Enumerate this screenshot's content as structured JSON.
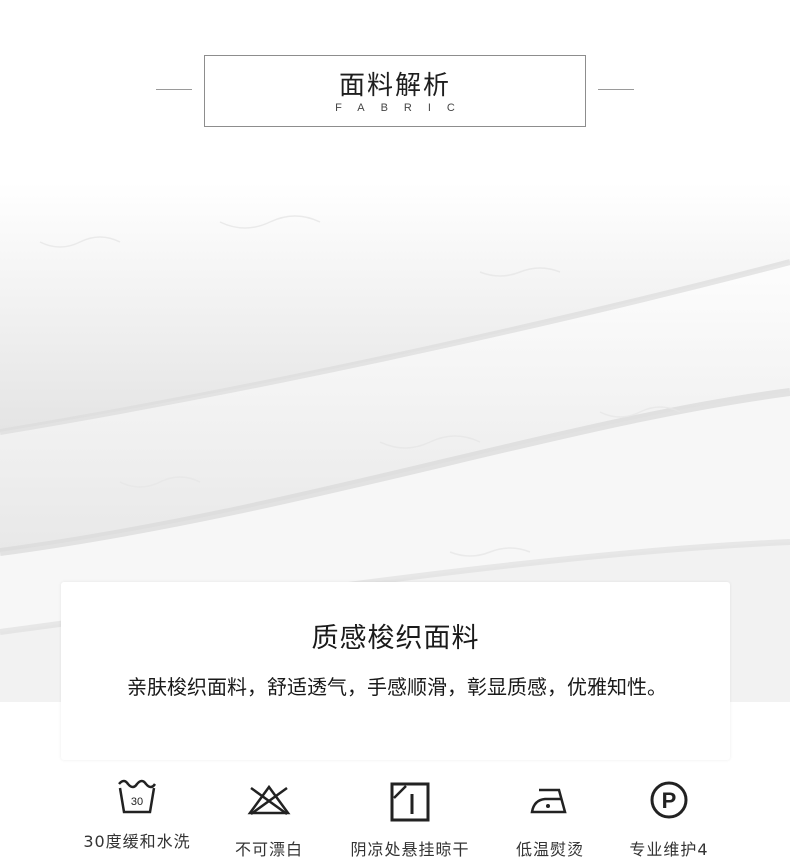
{
  "header": {
    "title_cn": "面料解析",
    "title_en": "FABRIC"
  },
  "feature": {
    "title": "质感梭织面料",
    "description": "亲肤梭织面料，舒适透气，手感顺滑，彰显质感，优雅知性。"
  },
  "care": [
    {
      "icon": "wash-30-icon",
      "label": "30度缓和水洗",
      "temp": "30"
    },
    {
      "icon": "no-bleach-icon",
      "label": "不可漂白"
    },
    {
      "icon": "shade-hang-dry-icon",
      "label": "阴凉处悬挂晾干"
    },
    {
      "icon": "low-iron-icon",
      "label": "低温熨烫"
    },
    {
      "icon": "professional-care-p-icon",
      "label": "专业维护4",
      "letter": "P"
    }
  ],
  "colors": {
    "text": "#1a1a1a",
    "line": "#8d8d8d",
    "fabric": "#f5f5f5"
  }
}
